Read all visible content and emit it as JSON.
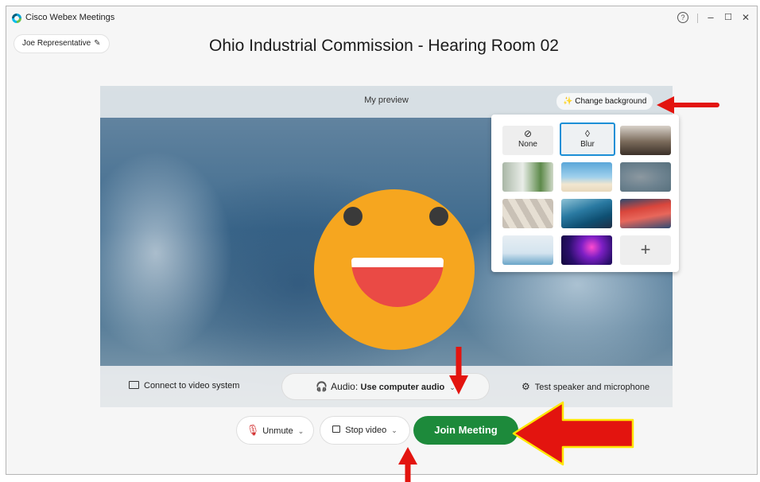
{
  "window": {
    "app_title": "Cisco Webex Meetings",
    "help_glyph": "?",
    "minimize_glyph": "–",
    "maximize_glyph": "☐",
    "close_glyph": "✕"
  },
  "header": {
    "user_name": "Joe Representative",
    "user_edit_icon": "pencil-icon",
    "meeting_title": "Ohio Industrial Commission - Hearing Room 02"
  },
  "preview": {
    "title": "My preview",
    "change_background_label": "Change background",
    "change_background_icon": "magic-wand-icon",
    "avatar": "smiley-face"
  },
  "background_panel": {
    "options": [
      {
        "label": "None",
        "glyph": "⊘",
        "kind": "none"
      },
      {
        "label": "Blur",
        "glyph": "◊",
        "kind": "blur",
        "selected": true
      },
      {
        "kind": "image",
        "theme": "modern-office"
      },
      {
        "kind": "image",
        "theme": "living-room-plants"
      },
      {
        "kind": "image",
        "theme": "tropical-beach"
      },
      {
        "kind": "image",
        "theme": "blurred-office"
      },
      {
        "kind": "image",
        "theme": "sunlit-wall-shadows"
      },
      {
        "kind": "image",
        "theme": "blue-mountains"
      },
      {
        "kind": "image",
        "theme": "red-geometric"
      },
      {
        "kind": "image",
        "theme": "illustrated-room"
      },
      {
        "kind": "image",
        "theme": "purple-space"
      },
      {
        "kind": "add",
        "glyph": "+"
      }
    ]
  },
  "device_bar": {
    "connect_label": "Connect to video system",
    "audio_prefix": "Audio:",
    "audio_value": "Use computer audio",
    "test_label": "Test speaker and microphone"
  },
  "controls": {
    "unmute_label": "Unmute",
    "stop_video_label": "Stop video",
    "join_label": "Join Meeting"
  },
  "colors": {
    "join": "#1d8a3b",
    "mute": "#d22f2f",
    "accent": "#1c8fd6",
    "annotation": "#e3140f"
  }
}
